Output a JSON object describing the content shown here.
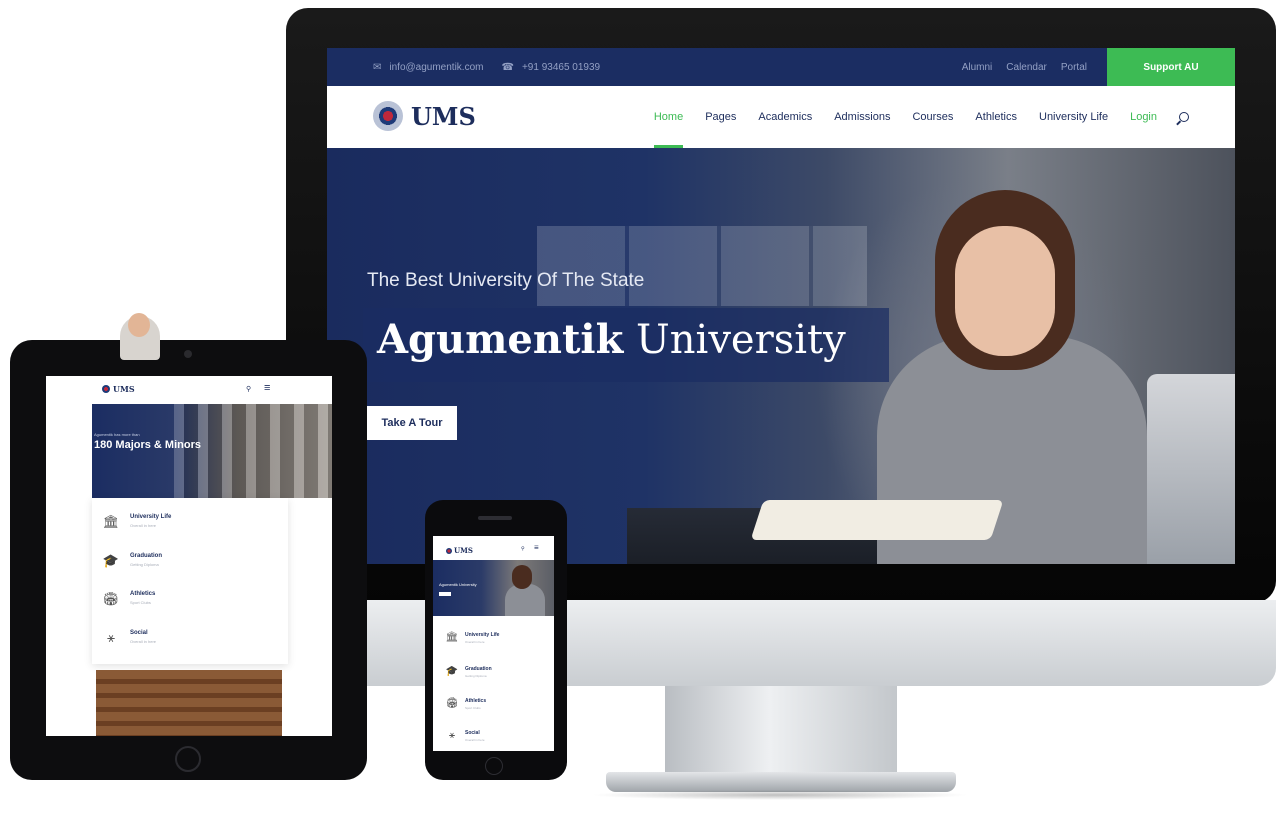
{
  "desktop": {
    "topbar": {
      "email": "info@agumentik.com",
      "phone": "+91 93465 01939",
      "links": [
        "Alumni",
        "Calendar",
        "Portal"
      ],
      "support_label": "Support AU"
    },
    "brand": "UMS",
    "nav": {
      "items": [
        "Home",
        "Pages",
        "Academics",
        "Admissions",
        "Courses",
        "Athletics",
        "University Life"
      ],
      "active": "Home",
      "login_label": "Login"
    },
    "hero": {
      "subtitle": "The Best University Of The State",
      "title_bold": "Agumentik",
      "title_light": "University",
      "cta_label": "Take A Tour"
    }
  },
  "tablet": {
    "brand": "UMS",
    "hero": {
      "kicker": "Agumentik has more than",
      "title": "180 Majors & Minors"
    },
    "features": [
      {
        "title": "University Life",
        "subtitle": "Overall in here"
      },
      {
        "title": "Graduation",
        "subtitle": "Getting Diploma"
      },
      {
        "title": "Athletics",
        "subtitle": "Sport Clubs"
      },
      {
        "title": "Social",
        "subtitle": "Overall in here"
      }
    ]
  },
  "phone": {
    "brand": "UMS",
    "hero_title": "Agumentik University",
    "features": [
      {
        "title": "University Life",
        "subtitle": "Overall in here"
      },
      {
        "title": "Graduation",
        "subtitle": "Getting Diploma"
      },
      {
        "title": "Athletics",
        "subtitle": "Sport Clubs"
      },
      {
        "title": "Social",
        "subtitle": "Overall in here"
      }
    ]
  },
  "icons": {
    "email": "envelope-icon",
    "phone": "phone-icon",
    "search": "search-icon",
    "menu": "hamburger-menu-icon",
    "university_life": "building-icon",
    "graduation": "graduation-cap-icon",
    "athletics": "stadium-icon",
    "social": "network-icon"
  },
  "colors": {
    "navy": "#1b2d62",
    "accent_green": "#3dbb54",
    "text_dark": "#1d2d5c",
    "muted": "#93a0c4"
  }
}
